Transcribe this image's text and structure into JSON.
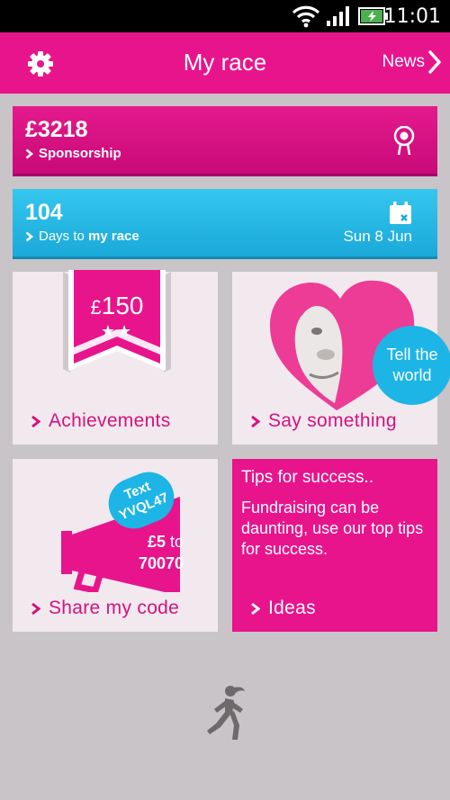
{
  "status": {
    "time": "11:01"
  },
  "header": {
    "title": "My race",
    "news_label": "News"
  },
  "sponsorship": {
    "amount": "£3218",
    "label": "Sponsorship"
  },
  "days": {
    "count": "104",
    "label_prefix": "Days to ",
    "label_bold": "my race",
    "date": "Sun 8 Jun"
  },
  "achievements": {
    "badge_currency": "£",
    "badge_amount": "150",
    "badge_stars": "★★",
    "link": "Achievements"
  },
  "say": {
    "bubble": "Tell the world",
    "link": "Say something"
  },
  "share": {
    "bubble_line1": "Text",
    "bubble_line2": "YVQL47",
    "amount": "£5",
    "to": "to",
    "number": "70070",
    "link": "Share my code"
  },
  "tips": {
    "title": "Tips for success..",
    "body": "Fundraising can be daunting, use our top tips for success.",
    "link": "Ideas"
  },
  "colors": {
    "brand_pink": "#e8148c",
    "accent_blue": "#1cb5e6",
    "background": "#c9c4c7"
  }
}
